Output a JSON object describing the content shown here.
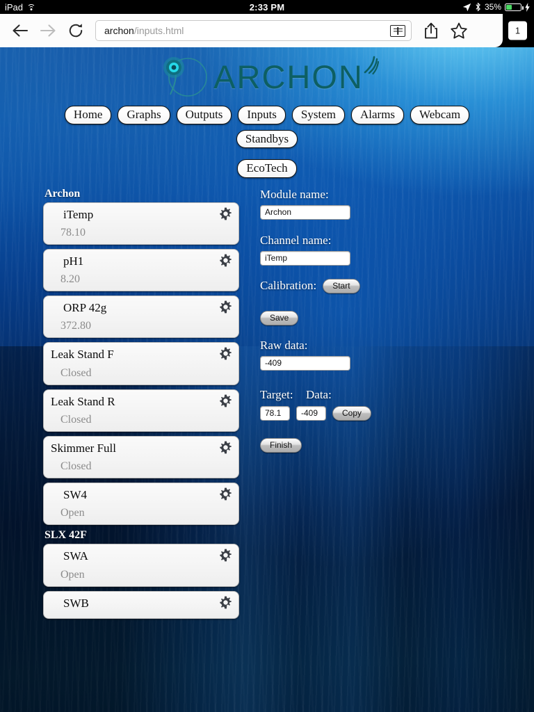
{
  "status_bar": {
    "carrier": "iPad",
    "wifi_icon": "wifi-icon",
    "time": "2:33 PM",
    "location_icon": "location-arrow-icon",
    "bluetooth_icon": "bluetooth-icon",
    "battery_percent": "35%",
    "battery_level": 35,
    "charging_icon": "lightning-bolt-icon",
    "battery_color": "#4cd964"
  },
  "browser": {
    "back_icon": "back-arrow-icon",
    "forward_icon": "forward-arrow-icon",
    "reload_icon": "reload-icon",
    "url_host": "archon",
    "url_path": "/inputs.html",
    "url_placeholder": "Search or enter website name",
    "reader_icon": "reader-view-icon",
    "share_icon": "share-icon",
    "bookmark_icon": "bookmark-star-icon",
    "tab_count": "1"
  },
  "site": {
    "logo_text": "ARCHON",
    "logo_color": "#0d5f63",
    "nav_primary": [
      {
        "label": "Home"
      },
      {
        "label": "Graphs"
      },
      {
        "label": "Outputs"
      },
      {
        "label": "Inputs"
      },
      {
        "label": "System"
      },
      {
        "label": "Alarms"
      },
      {
        "label": "Webcam"
      },
      {
        "label": "Standbys"
      }
    ],
    "nav_secondary": [
      {
        "label": "EcoTech"
      }
    ]
  },
  "channel_list": {
    "groups": [
      {
        "title": "Archon",
        "items": [
          {
            "name": "iTemp",
            "value": "78.10",
            "indent": true,
            "gear_icon": "gear-icon"
          },
          {
            "name": "pH1",
            "value": "8.20",
            "indent": true,
            "gear_icon": "gear-icon"
          },
          {
            "name": "ORP 42g",
            "value": "372.80",
            "indent": true,
            "gear_icon": "gear-icon"
          },
          {
            "name": "Leak Stand F",
            "value": "Closed",
            "indent": false,
            "gear_icon": "gear-icon"
          },
          {
            "name": "Leak Stand R",
            "value": "Closed",
            "indent": false,
            "gear_icon": "gear-icon"
          },
          {
            "name": "Skimmer Full",
            "value": "Closed",
            "indent": false,
            "gear_icon": "gear-icon"
          },
          {
            "name": "SW4",
            "value": "Open",
            "indent": true,
            "gear_icon": "gear-icon"
          }
        ]
      },
      {
        "title": "SLX 42F",
        "items": [
          {
            "name": "SWA",
            "value": "Open",
            "indent": true,
            "gear_icon": "gear-icon"
          },
          {
            "name": "SWB",
            "value": "",
            "indent": true,
            "gear_icon": "gear-icon",
            "truncated": true
          }
        ]
      }
    ]
  },
  "form": {
    "module_name_label": "Module name:",
    "module_name_value": "Archon",
    "channel_name_label": "Channel name:",
    "channel_name_value": "iTemp",
    "calibration_label": "Calibration:",
    "start_button": "Start",
    "save_button": "Save",
    "raw_data_label": "Raw data:",
    "raw_data_value": "-409",
    "target_label": "Target:",
    "data_label": "Data:",
    "target_value": "78.1",
    "data_value": "-409",
    "copy_button": "Copy",
    "finish_button": "Finish"
  }
}
